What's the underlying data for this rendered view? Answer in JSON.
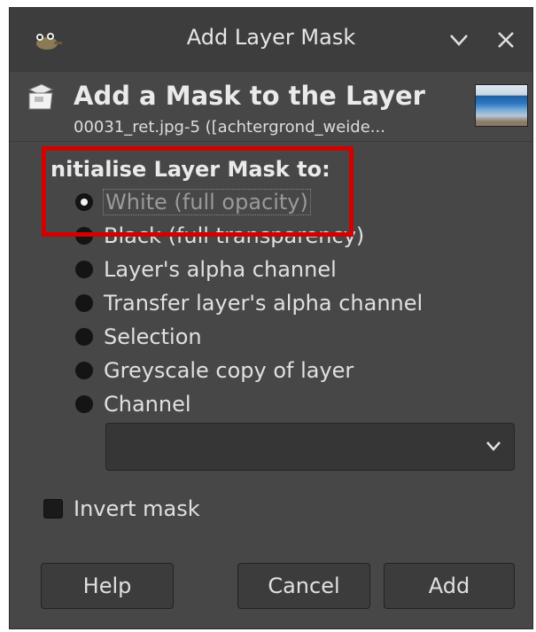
{
  "window": {
    "title": "Add Layer Mask",
    "icon": "wilber-icon"
  },
  "header": {
    "heading": "Add a Mask to the Layer",
    "subtitle": "00031_ret.jpg-5 ([achtergrond_weide...",
    "icon": "layer-mask-icon"
  },
  "group": {
    "label": "nitialise Layer Mask to:",
    "options": [
      {
        "label": "White (full opacity)",
        "selected": true
      },
      {
        "label": "Black (full transparency)",
        "selected": false
      },
      {
        "label": "Layer's alpha channel",
        "selected": false
      },
      {
        "label": "Transfer layer's alpha channel",
        "selected": false
      },
      {
        "label": "Selection",
        "selected": false
      },
      {
        "label": "Greyscale copy of layer",
        "selected": false
      },
      {
        "label": "Channel",
        "selected": false
      }
    ]
  },
  "channel_select": {
    "value": ""
  },
  "invert": {
    "label": "Invert mask",
    "checked": false
  },
  "buttons": {
    "help": "Help",
    "cancel": "Cancel",
    "add": "Add"
  },
  "colors": {
    "background": "#474747",
    "highlight": "#d40000"
  }
}
